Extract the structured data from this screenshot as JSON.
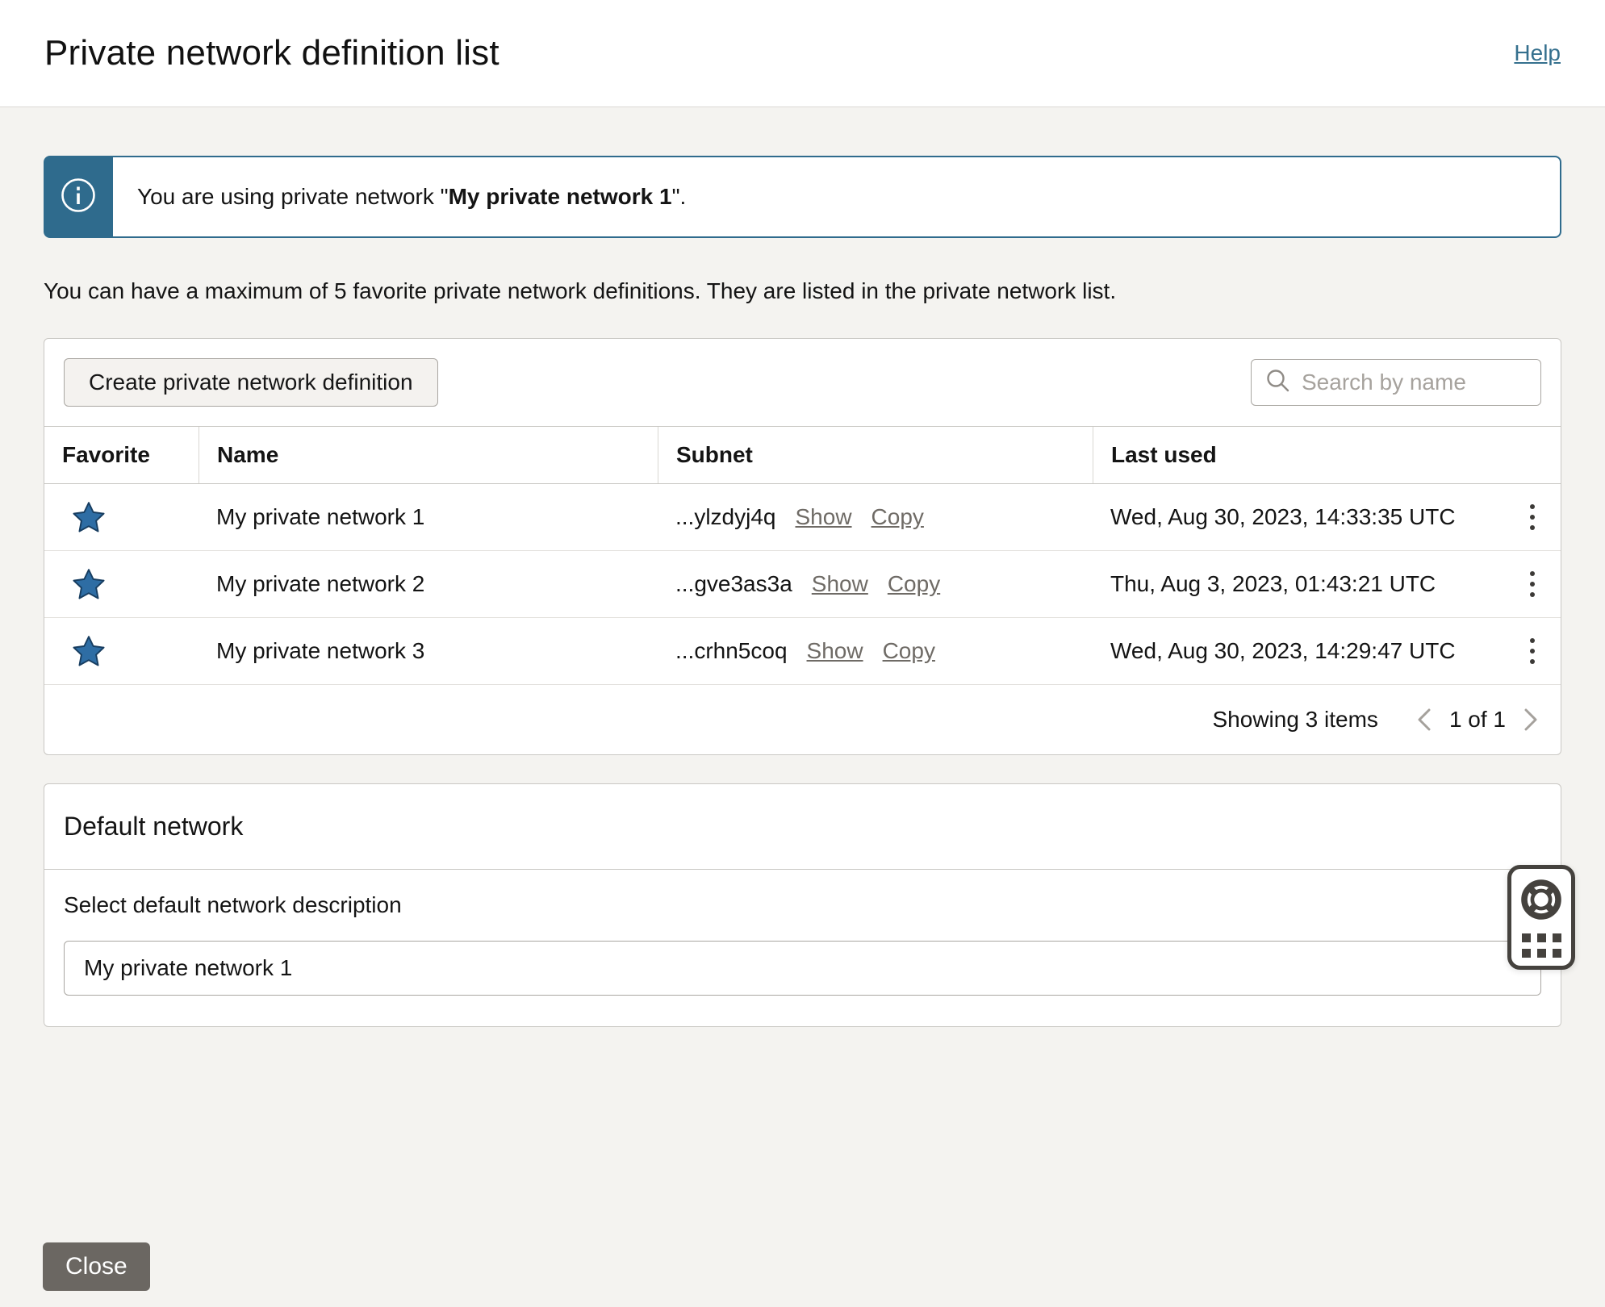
{
  "header": {
    "title": "Private network definition list",
    "help_label": "Help"
  },
  "banner": {
    "message_prefix": "You are using private network \"",
    "network_name": "My private network 1",
    "message_suffix": "\"."
  },
  "intro_text": "You can have a maximum of 5 favorite private network definitions. They are listed in the private network list.",
  "toolbar": {
    "create_button_label": "Create private network definition",
    "search_placeholder": "Search by name"
  },
  "table": {
    "columns": [
      "Favorite",
      "Name",
      "Subnet",
      "Last used"
    ],
    "rows": [
      {
        "favorite": true,
        "name": "My private network 1",
        "subnet": "...ylzdyj4q",
        "show_label": "Show",
        "copy_label": "Copy",
        "last_used": "Wed, Aug 30, 2023, 14:33:35 UTC"
      },
      {
        "favorite": true,
        "name": "My private network 2",
        "subnet": "...gve3as3a",
        "show_label": "Show",
        "copy_label": "Copy",
        "last_used": "Thu, Aug 3, 2023, 01:43:21 UTC"
      },
      {
        "favorite": true,
        "name": "My private network 3",
        "subnet": "...crhn5coq",
        "show_label": "Show",
        "copy_label": "Copy",
        "last_used": "Wed, Aug 30, 2023, 14:29:47 UTC"
      }
    ],
    "footer": {
      "summary": "Showing 3 items",
      "page_indicator": "1 of 1"
    }
  },
  "default_network": {
    "title": "Default network",
    "label": "Select default network description",
    "value": "My private network 1"
  },
  "close_button_label": "Close",
  "colors": {
    "info_teal": "#2f6b8d",
    "star_blue": "#2e6da4",
    "link_gray": "#6f6b66",
    "help_link_blue": "#35708e",
    "close_button_gray": "#6b6762",
    "widget_dark": "#45423e",
    "page_background": "#f4f3f0"
  }
}
